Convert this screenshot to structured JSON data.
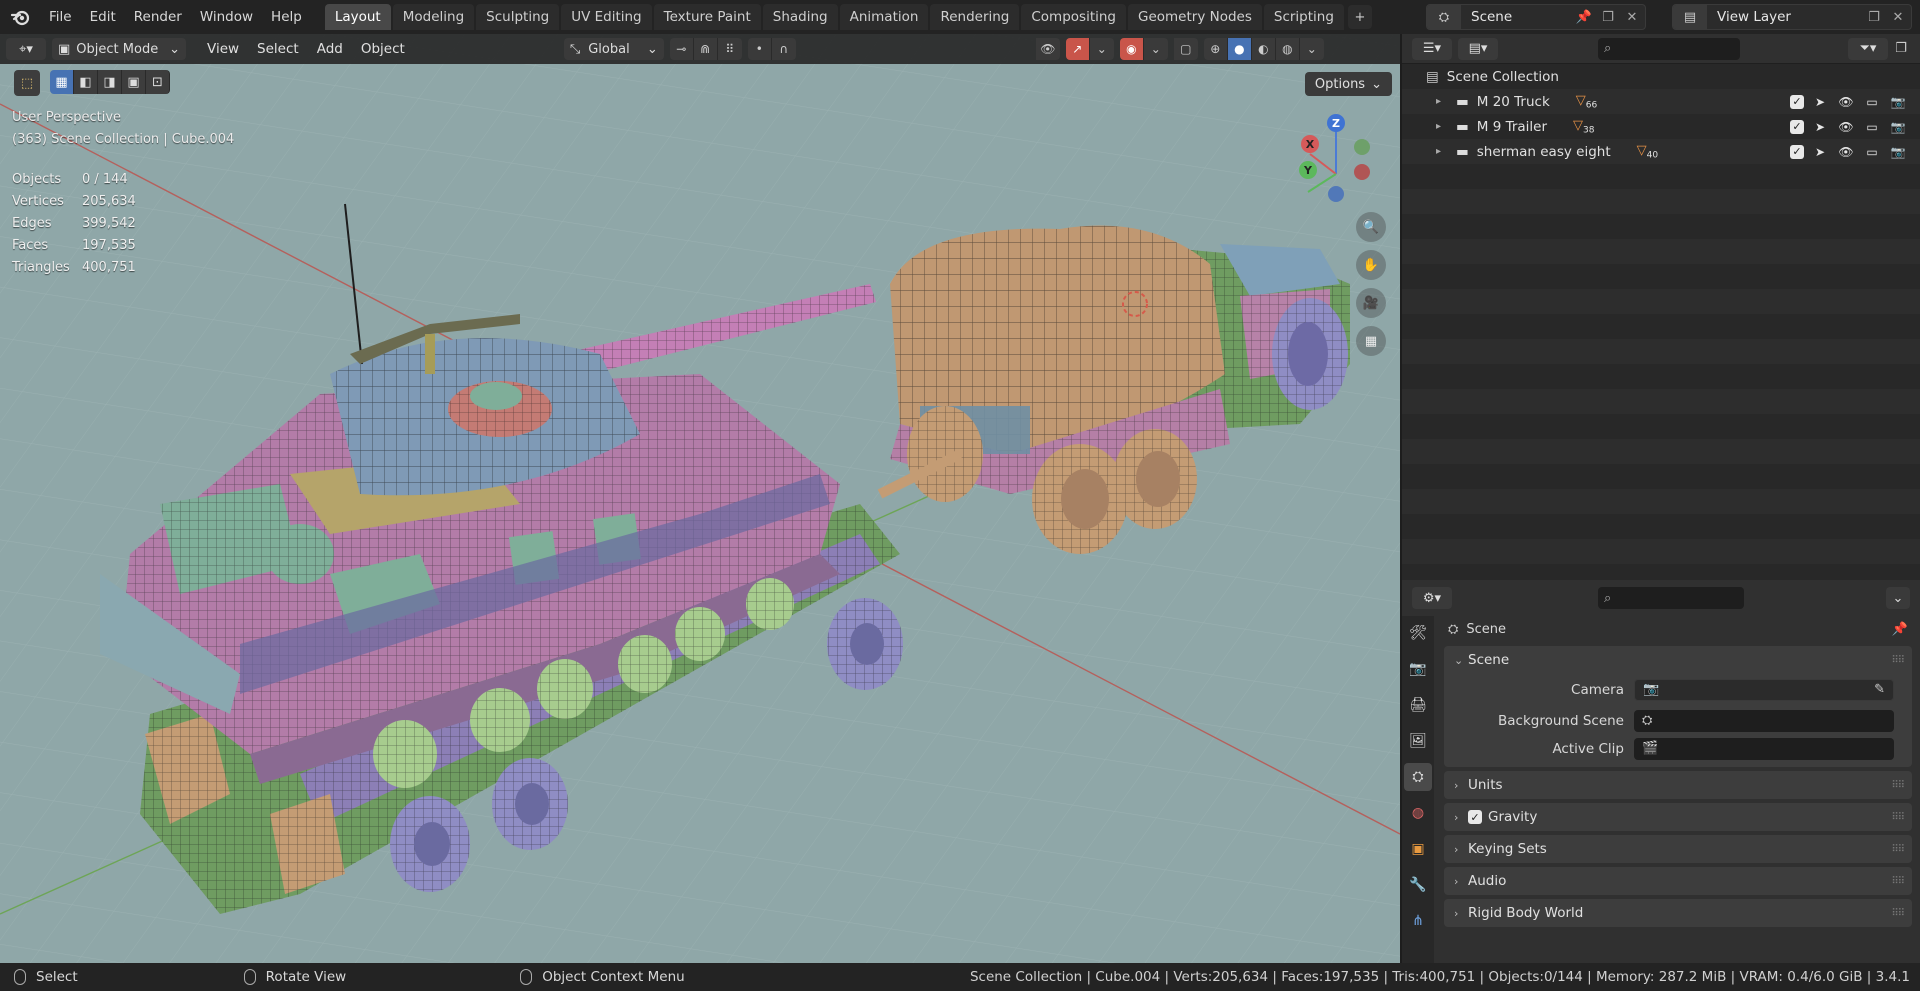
{
  "menu": {
    "file": "File",
    "edit": "Edit",
    "render": "Render",
    "window": "Window",
    "help": "Help"
  },
  "workspaces": [
    "Layout",
    "Modeling",
    "Sculpting",
    "UV Editing",
    "Texture Paint",
    "Shading",
    "Animation",
    "Rendering",
    "Compositing",
    "Geometry Nodes",
    "Scripting"
  ],
  "active_workspace": "Layout",
  "scene": {
    "name": "Scene",
    "view_layer": "View Layer"
  },
  "viewport": {
    "mode": "Object Mode",
    "menus": {
      "view": "View",
      "select": "Select",
      "add": "Add",
      "object": "Object"
    },
    "orientation": "Global",
    "options": "Options",
    "perspective": "User Perspective",
    "context": "(363) Scene Collection | Cube.004",
    "stats": [
      {
        "label": "Objects",
        "value": "0 / 144"
      },
      {
        "label": "Vertices",
        "value": "205,634"
      },
      {
        "label": "Edges",
        "value": "399,542"
      },
      {
        "label": "Faces",
        "value": "197,535"
      },
      {
        "label": "Triangles",
        "value": "400,751"
      }
    ],
    "gizmo": {
      "x": "X",
      "y": "Y",
      "z": "Z"
    }
  },
  "outliner": {
    "root": "Scene Collection",
    "items": [
      {
        "label": "M 20 Truck",
        "count": "66"
      },
      {
        "label": "M 9 Trailer",
        "count": "38"
      },
      {
        "label": "sherman easy eight",
        "count": "40"
      }
    ]
  },
  "properties": {
    "context": "Scene",
    "panel_scene": "Scene",
    "camera_label": "Camera",
    "bg_scene_label": "Background Scene",
    "active_clip_label": "Active Clip",
    "panels": [
      "Units",
      "Gravity",
      "Keying Sets",
      "Audio",
      "Rigid Body World"
    ]
  },
  "statusbar": {
    "select": "Select",
    "rotate": "Rotate View",
    "context_menu": "Object Context Menu",
    "info": "Scene Collection | Cube.004 | Verts:205,634 | Faces:197,535 | Tris:400,751 | Objects:0/144 | Memory: 287.2 MiB | VRAM: 0.4/6.0 GiB | 3.4.1"
  },
  "colors": {
    "accent": "#4772b3",
    "viewport_bg": "#8fa7a8",
    "tank_pink": "#b37ca8",
    "tank_turret": "#7f9ab6",
    "trailer_green": "#7ea870",
    "truck_tan": "#c49c74"
  }
}
